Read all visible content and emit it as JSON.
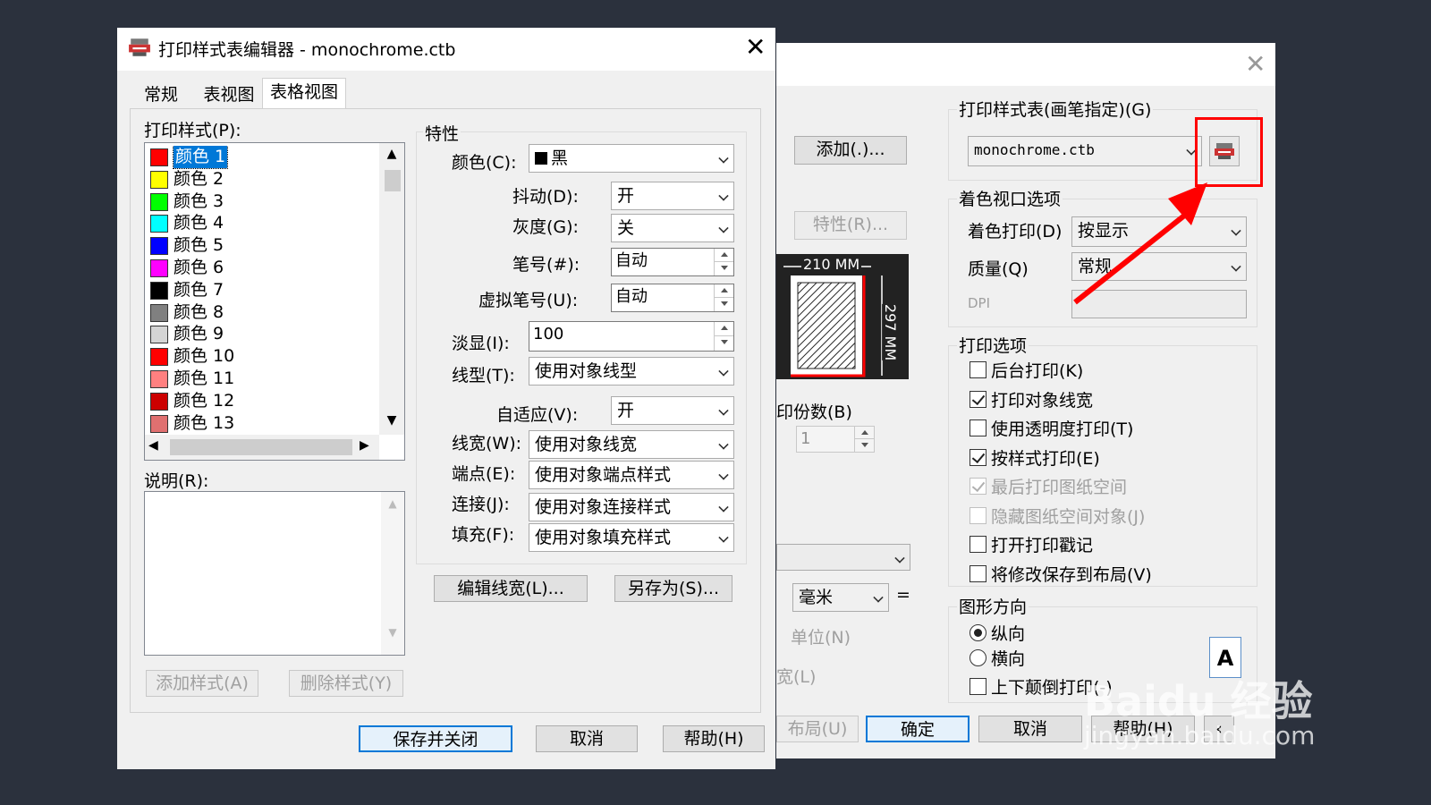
{
  "editor": {
    "title": "打印样式表编辑器 - monochrome.ctb",
    "tabs": [
      "常规",
      "表视图",
      "表格视图"
    ],
    "styles_label": "打印样式(P):",
    "styles": [
      {
        "name": "颜色 1",
        "color": "#ff0000"
      },
      {
        "name": "颜色 2",
        "color": "#ffff00"
      },
      {
        "name": "颜色 3",
        "color": "#00ff00"
      },
      {
        "name": "颜色 4",
        "color": "#00ffff"
      },
      {
        "name": "颜色 5",
        "color": "#0000ff"
      },
      {
        "name": "颜色 6",
        "color": "#ff00ff"
      },
      {
        "name": "颜色 7",
        "color": "#000000"
      },
      {
        "name": "颜色 8",
        "color": "#808080"
      },
      {
        "name": "颜色 9",
        "color": "#d4d4d4"
      },
      {
        "name": "颜色 10",
        "color": "#ff0000"
      },
      {
        "name": "颜色 11",
        "color": "#ff8080"
      },
      {
        "name": "颜色 12",
        "color": "#cc0000"
      },
      {
        "name": "颜色 13",
        "color": "#e07070"
      }
    ],
    "desc_label": "说明(R):",
    "add_style": "添加样式(A)",
    "del_style": "删除样式(Y)",
    "props_title": "特性",
    "color_label": "颜色(C):",
    "color_value": "黑",
    "dither_label": "抖动(D):",
    "dither_value": "开",
    "gray_label": "灰度(G):",
    "gray_value": "关",
    "pen_label": "笔号(#):",
    "pen_value": "自动",
    "vpen_label": "虚拟笔号(U):",
    "vpen_value": "自动",
    "screen_label": "淡显(I):",
    "screen_value": "100",
    "ltype_label": "线型(T):",
    "ltype_value": "使用对象线型",
    "adapt_label": "自适应(V):",
    "adapt_value": "开",
    "lw_label": "线宽(W):",
    "lw_value": "使用对象线宽",
    "end_label": "端点(E):",
    "end_value": "使用对象端点样式",
    "join_label": "连接(J):",
    "join_value": "使用对象连接样式",
    "fill_label": "填充(F):",
    "fill_value": "使用对象填充样式",
    "edit_lw": "编辑线宽(L)...",
    "save_as": "另存为(S)...",
    "save_close": "保存并关闭",
    "cancel": "取消",
    "help": "帮助(H)"
  },
  "plot": {
    "add_btn": "添加(.)...",
    "props_btn": "特性(R)...",
    "paper_w": "210 MM",
    "paper_h": "297 MM",
    "copies_label": "印份数(B)",
    "copies_value": "1",
    "unit_value": "毫米",
    "unit_label": "单位(N)",
    "width_label": "宽(L)",
    "pst_title": "打印样式表(画笔指定)(G)",
    "pst_value": "monochrome.ctb",
    "shade_title": "着色视口选项",
    "shade_label": "着色打印(D)",
    "shade_value": "按显示",
    "quality_label": "质量(Q)",
    "quality_value": "常规",
    "dpi_label": "DPI",
    "options_title": "打印选项",
    "options": [
      {
        "label": "后台打印(K)",
        "checked": false,
        "disabled": false
      },
      {
        "label": "打印对象线宽",
        "checked": true,
        "disabled": false
      },
      {
        "label": "使用透明度打印(T)",
        "checked": false,
        "disabled": false
      },
      {
        "label": "按样式打印(E)",
        "checked": true,
        "disabled": false
      },
      {
        "label": "最后打印图纸空间",
        "checked": true,
        "disabled": true
      },
      {
        "label": "隐藏图纸空间对象(J)",
        "checked": false,
        "disabled": true
      },
      {
        "label": "打开打印戳记",
        "checked": false,
        "disabled": false
      },
      {
        "label": "将修改保存到布局(V)",
        "checked": false,
        "disabled": false
      }
    ],
    "orient_title": "图形方向",
    "portrait": "纵向",
    "landscape": "横向",
    "upside": "上下颠倒打印(-)",
    "layout_btn": "布局(U)",
    "ok": "确定",
    "cancel": "取消",
    "help": "帮助(H)",
    "orient_icon_letter": "A"
  },
  "watermark": {
    "brand": "Baidu 经验",
    "url": "jingyan.baidu.com"
  },
  "colors": {
    "highlight": "#ff0000",
    "accent": "#0078d7"
  }
}
